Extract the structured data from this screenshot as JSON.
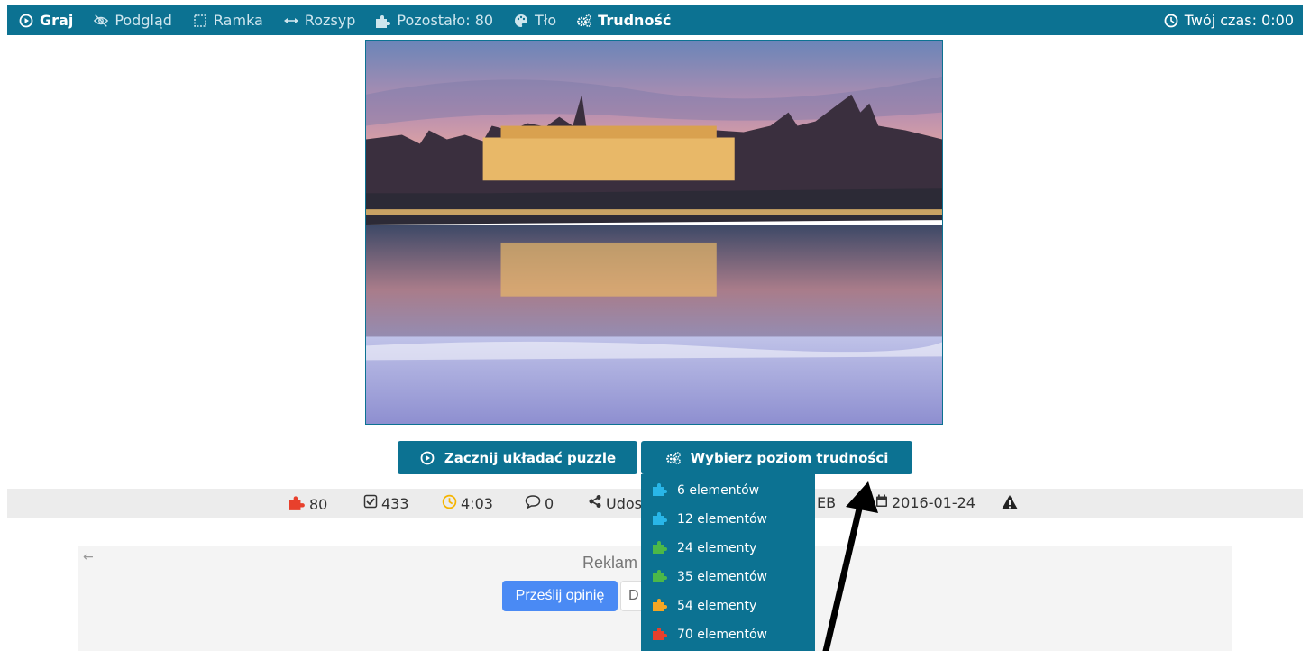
{
  "toolbar": {
    "play": "Graj",
    "preview": "Podgląd",
    "frame": "Ramka",
    "scatter": "Rozsyp",
    "remaining": "Pozostało: 80",
    "background": "Tło",
    "difficulty": "Trudność",
    "timer": "Twój czas: 0:00"
  },
  "buttons": {
    "start": "Zacznij układać puzzle",
    "difficulty": "Wybierz poziom trudności"
  },
  "stats": {
    "pieces": "80",
    "solved": "433",
    "time": "4:03",
    "comments": "0",
    "share": "Udos",
    "partial": "EB",
    "date": "2016-01-24"
  },
  "ad": {
    "title": "Reklam",
    "send_feedback": "Prześlij opinię",
    "second_partial": "D"
  },
  "difficulty_menu": [
    {
      "label": "6 elementów",
      "color": "#29b6e8"
    },
    {
      "label": "12 elementów",
      "color": "#29b6e8"
    },
    {
      "label": "24 elementy",
      "color": "#4cb848"
    },
    {
      "label": "35 elementów",
      "color": "#4cb848"
    },
    {
      "label": "54 elementy",
      "color": "#f5a623"
    },
    {
      "label": "70 elementów",
      "color": "#e8402c"
    }
  ],
  "colors": {
    "primary": "#0c7292",
    "stat_pieces": "#e8402c",
    "stat_time": "#f5b400"
  }
}
